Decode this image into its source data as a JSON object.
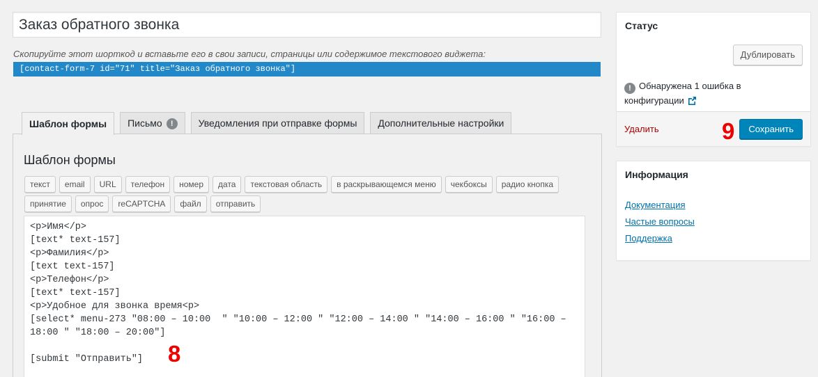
{
  "form": {
    "title_value": "Заказ обратного звонка",
    "shortcode_hint": "Скопируйте этот шорткод и вставьте его в свои записи, страницы или содержимое текстового виджета:",
    "shortcode": "[contact-form-7 id=\"71\" title=\"Заказ обратного звонка\"]"
  },
  "tabs": [
    {
      "label": "Шаблон формы",
      "active": true
    },
    {
      "label": "Письмо",
      "warning": "!"
    },
    {
      "label": "Уведомления при отправке формы"
    },
    {
      "label": "Дополнительные настройки"
    }
  ],
  "panel": {
    "title": "Шаблон формы",
    "tag_buttons": [
      "текст",
      "email",
      "URL",
      "телефон",
      "номер",
      "дата",
      "текстовая область",
      "в раскрывающемся меню",
      "чекбоксы",
      "радио кнопка",
      "принятие",
      "опрос",
      "reCAPTCHA",
      "файл",
      "отправить"
    ],
    "code_lines": [
      "<p>Имя</p>",
      "[text* text-157]",
      "<p>Фамилия</p>",
      "[text text-157]",
      "<p>Телефон</p>",
      "[text* text-157]",
      "<p>Удобное для звонка время<p>",
      "[select* menu-273 \"08:00 – 10:00  \" \"10:00 – 12:00 \" \"12:00 – 14:00 \" \"14:00 – 16:00 \" \"16:00 – 18:00 \" \"18:00 – 20:00\"]",
      "",
      "[submit \"Отправить\"]"
    ]
  },
  "markers": {
    "eight": "8",
    "nine": "9"
  },
  "status": {
    "title": "Статус",
    "duplicate_label": "Дублировать",
    "error_icon": "!",
    "error_text": "Обнаружена 1 ошибка в конфигурации",
    "delete_label": "Удалить",
    "save_label": "Сохранить"
  },
  "info": {
    "title": "Информация",
    "links": [
      "Документация",
      "Частые вопросы",
      "Поддержка"
    ]
  },
  "colors": {
    "accent": "#0085ba",
    "shortcode_bg": "#2288c8",
    "delete": "#a00",
    "marker": "#e00"
  }
}
